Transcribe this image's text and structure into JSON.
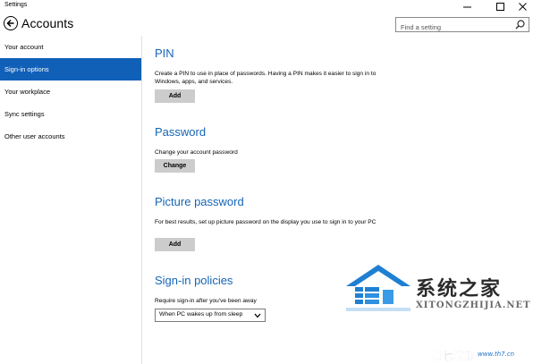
{
  "window": {
    "title": "Settings"
  },
  "header": {
    "title": "Accounts",
    "search_placeholder": "Find a setting"
  },
  "sidebar": {
    "items": [
      {
        "label": "Your account"
      },
      {
        "label": "Sign-in options",
        "active": true
      },
      {
        "label": "Your workplace"
      },
      {
        "label": "Sync settings"
      },
      {
        "label": "Other user accounts"
      }
    ]
  },
  "main": {
    "pin": {
      "title": "PIN",
      "description": "Create a PIN to use in place of passwords. Having a PIN makes it easier to sign in to Windows, apps, and services.",
      "button": "Add"
    },
    "password": {
      "title": "Password",
      "description": "Change your account password",
      "button": "Change"
    },
    "picture_password": {
      "title": "Picture password",
      "description": "For best results, set up picture password on the display you use to sign in to your PC",
      "button": "Add"
    },
    "signin_policies": {
      "title": "Sign-in policies",
      "description": "Require sign-in after you've been away",
      "selected": "When PC wakes up from sleep"
    }
  },
  "watermark": {
    "cn": "系统之家",
    "en": "XITONGZHIJIA.NET",
    "bottom_cn": "第七城市",
    "bottom_url": "www.th7.cn"
  },
  "colors": {
    "accent": "#1160b8",
    "section_title": "#1565b6",
    "button_bg": "#cccccc"
  },
  "icons": {
    "back": "back-arrow-icon",
    "search": "search-icon",
    "minimize": "minimize-icon",
    "maximize": "maximize-icon",
    "close": "close-icon",
    "dropdown": "chevron-down-icon"
  }
}
